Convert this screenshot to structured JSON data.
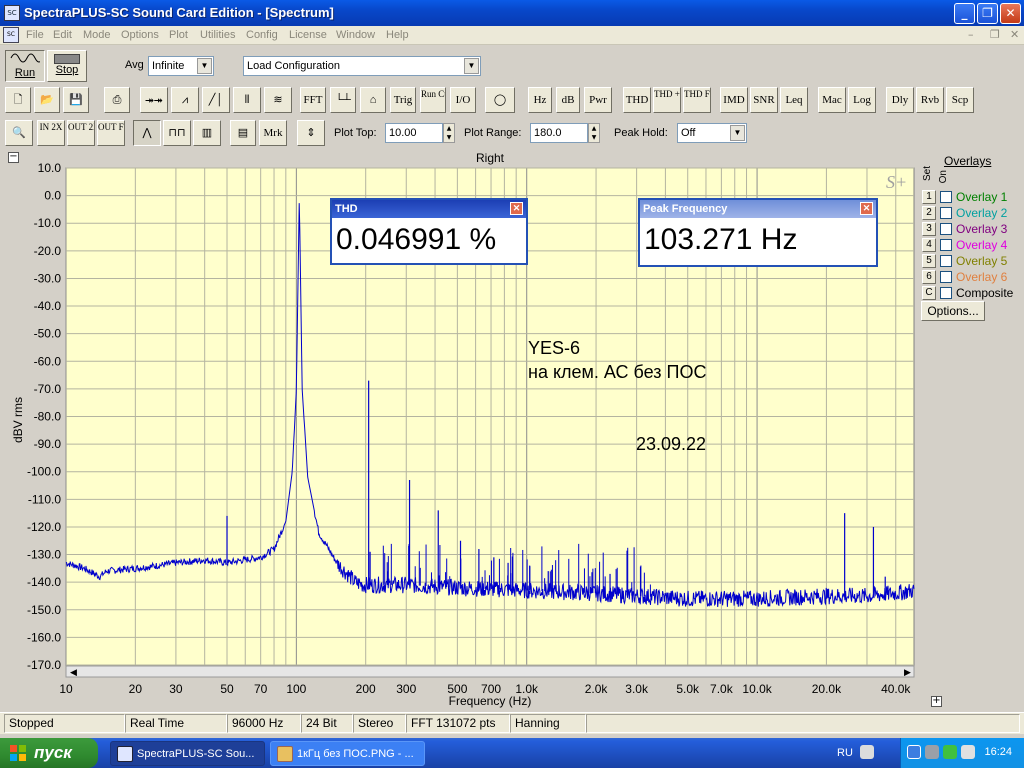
{
  "window": {
    "title": "SpectraPLUS-SC Sound Card Edition - [Spectrum]"
  },
  "menu": [
    "File",
    "Edit",
    "Mode",
    "Options",
    "Plot",
    "Utilities",
    "Config",
    "License",
    "Window",
    "Help"
  ],
  "toolbar1": {
    "run_label": "Run",
    "stop_label": "Stop",
    "avg_label": "Avg",
    "avg_value": "Infinite",
    "config_value": "Load Configuration"
  },
  "toolbar2": {
    "buttons": [
      "FFT",
      "Trig",
      "Run Ctrl",
      "I/O",
      "Hz",
      "dB",
      "Pwr",
      "THD",
      "THD +N",
      "THD Freq",
      "IMD",
      "SNR",
      "Leq",
      "Mac",
      "Log",
      "Dly",
      "Rvb",
      "Scp"
    ]
  },
  "toolbar3": {
    "zoom_in_label": "IN 2X",
    "zoom_out_label": "OUT 2X",
    "zoom_full_label": "OUT FULL",
    "marker_label": "Mrk",
    "plot_top_label": "Plot Top:",
    "plot_top_value": "10.00",
    "plot_range_label": "Plot Range:",
    "plot_range_value": "180.0",
    "peak_hold_label": "Peak Hold:",
    "peak_hold_value": "Off"
  },
  "plot": {
    "channel_title": "Right",
    "logo": "S+"
  },
  "chart_data": {
    "type": "line",
    "title": "Right",
    "xlabel": "Frequency (Hz)",
    "ylabel": "dBV rms",
    "xscale": "log",
    "xlim": [
      10,
      48000
    ],
    "ylim": [
      -170,
      10
    ],
    "grid": true,
    "line_color": "#0000cc",
    "background": "#ffffcc",
    "y_ticks": [
      "10.0",
      "0.0",
      "-10.0",
      "-20.0",
      "-30.0",
      "-40.0",
      "-50.0",
      "-60.0",
      "-70.0",
      "-80.0",
      "-90.0",
      "-100.0",
      "-110.0",
      "-120.0",
      "-130.0",
      "-140.0",
      "-150.0",
      "-160.0",
      "-170.0"
    ],
    "x_ticks": [
      {
        "v": 10,
        "t": "10"
      },
      {
        "v": 20,
        "t": "20"
      },
      {
        "v": 30,
        "t": "30"
      },
      {
        "v": 50,
        "t": "50"
      },
      {
        "v": 70,
        "t": "70"
      },
      {
        "v": 100,
        "t": "100"
      },
      {
        "v": 200,
        "t": "200"
      },
      {
        "v": 300,
        "t": "300"
      },
      {
        "v": 500,
        "t": "500"
      },
      {
        "v": 700,
        "t": "700"
      },
      {
        "v": 1000,
        "t": "1.0k"
      },
      {
        "v": 2000,
        "t": "2.0k"
      },
      {
        "v": 3000,
        "t": "3.0k"
      },
      {
        "v": 5000,
        "t": "5.0k"
      },
      {
        "v": 7000,
        "t": "7.0k"
      },
      {
        "v": 10000,
        "t": "10.0k"
      },
      {
        "v": 20000,
        "t": "20.0k"
      },
      {
        "v": 40000,
        "t": "40.0k"
      }
    ],
    "floor": [
      [
        10,
        -133
      ],
      [
        12,
        -135
      ],
      [
        14,
        -138
      ],
      [
        15,
        -136
      ],
      [
        20,
        -135
      ],
      [
        25,
        -134
      ],
      [
        30,
        -133
      ],
      [
        40,
        -132
      ],
      [
        50,
        -133
      ],
      [
        70,
        -131
      ],
      [
        80,
        -128
      ],
      [
        90,
        -118
      ],
      [
        96,
        -100
      ],
      [
        100,
        -70
      ],
      [
        103,
        0
      ],
      [
        106,
        -70
      ],
      [
        112,
        -102
      ],
      [
        125,
        -122
      ],
      [
        150,
        -133
      ],
      [
        180,
        -140
      ],
      [
        195,
        -141
      ],
      [
        300,
        -141
      ],
      [
        500,
        -142
      ],
      [
        1000,
        -143
      ],
      [
        2000,
        -144
      ],
      [
        3000,
        -145
      ],
      [
        5000,
        -146
      ],
      [
        7000,
        -146
      ],
      [
        10000,
        -146
      ],
      [
        20000,
        -145
      ],
      [
        30000,
        -145
      ],
      [
        40000,
        -144
      ],
      [
        48000,
        -143
      ]
    ],
    "peaks": [
      [
        50,
        -116
      ],
      [
        206,
        -67
      ],
      [
        209,
        -129
      ],
      [
        310,
        -103
      ],
      [
        413,
        -114
      ],
      [
        516,
        -125
      ],
      [
        620,
        -128
      ],
      [
        720,
        -131
      ],
      [
        830,
        -133
      ],
      [
        1030,
        -134
      ],
      [
        1240,
        -136
      ],
      [
        2300,
        -137
      ],
      [
        24000,
        -115
      ],
      [
        32000,
        -120
      ],
      [
        36000,
        -138
      ]
    ],
    "annotations": [
      "YES-6",
      "на клем. АС без ПОС",
      "23.09.22"
    ]
  },
  "meters": {
    "thd": {
      "title": "THD",
      "value": "0.046991 %"
    },
    "peak": {
      "title": "Peak Frequency",
      "value": "103.271 Hz"
    }
  },
  "overlays": {
    "title": "Overlays",
    "set_label": "Set",
    "on_label": "On",
    "items": [
      {
        "num": "1",
        "name": "Overlay 1",
        "color": "#008000"
      },
      {
        "num": "2",
        "name": "Overlay 2",
        "color": "#00a0a0"
      },
      {
        "num": "3",
        "name": "Overlay 3",
        "color": "#800080"
      },
      {
        "num": "4",
        "name": "Overlay 4",
        "color": "#e000e0"
      },
      {
        "num": "5",
        "name": "Overlay 5",
        "color": "#808000"
      },
      {
        "num": "6",
        "name": "Overlay 6",
        "color": "#e08040"
      },
      {
        "num": "C",
        "name": "Composite",
        "color": "#000000"
      }
    ],
    "options_label": "Options..."
  },
  "status": [
    "Stopped",
    "Real Time",
    "96000 Hz",
    "24 Bit",
    "Stereo",
    "FFT 131072 pts",
    "Hanning"
  ],
  "taskbar": {
    "start_label": "пуск",
    "tasks": [
      "SpectraPLUS-SC Sou...",
      "1кГц без ПОС.PNG - ..."
    ],
    "language": "RU",
    "clock": "16:24"
  }
}
